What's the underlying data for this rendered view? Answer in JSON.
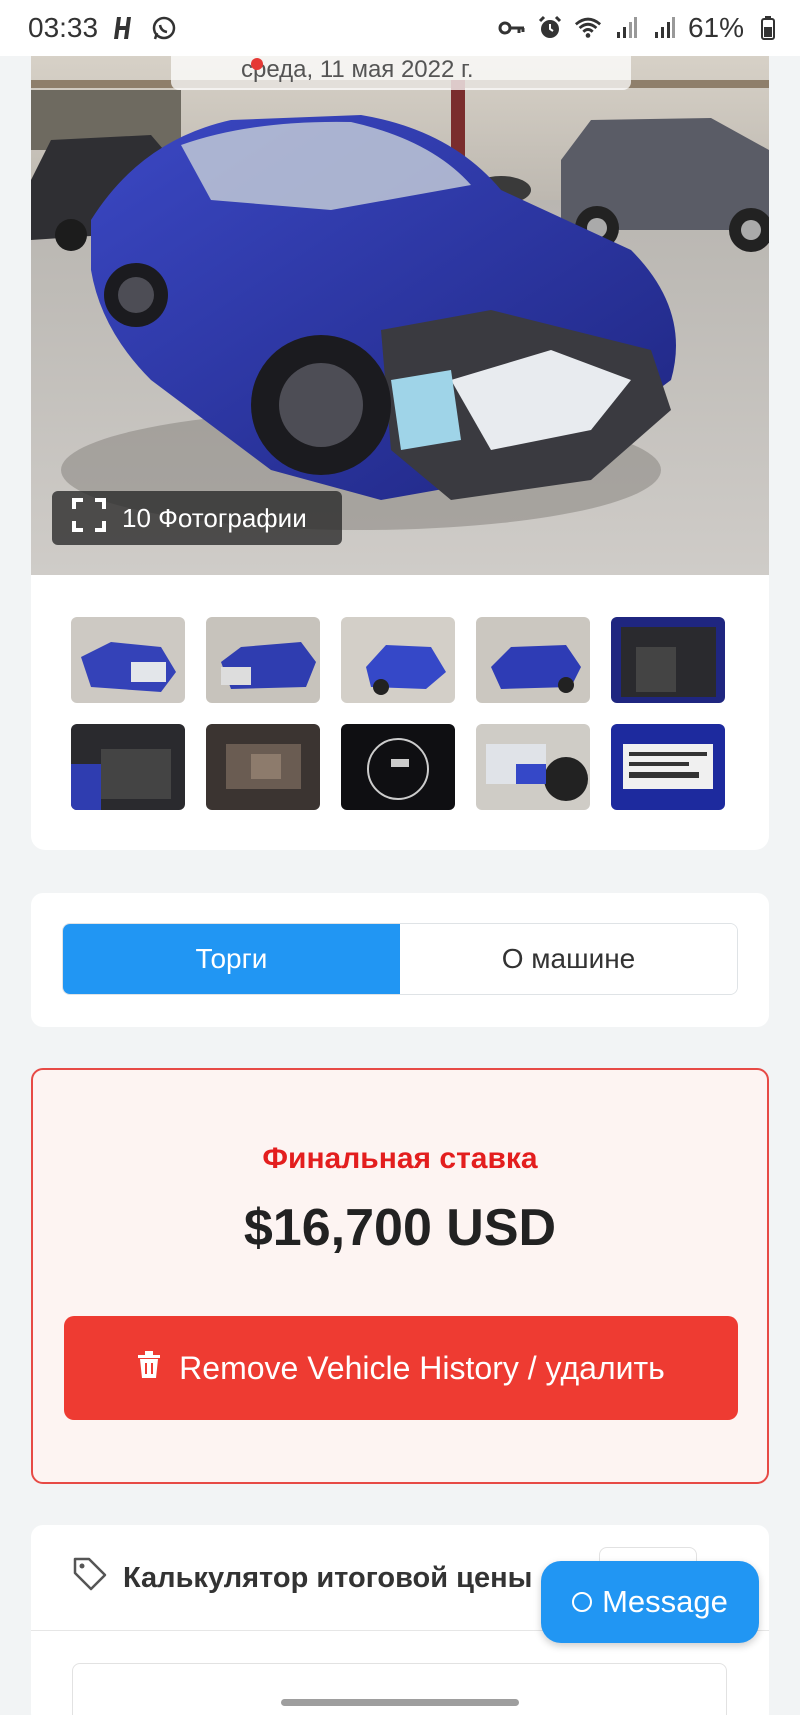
{
  "status_bar": {
    "time": "03:33",
    "battery": "61%",
    "icons": [
      "h-icon",
      "whatsapp-icon",
      "key-icon",
      "alarm-icon",
      "wifi-icon",
      "signal-icon",
      "signal-icon",
      "battery-icon"
    ]
  },
  "gallery": {
    "date_text": "среда, 11 мая 2022 г.",
    "photo_count_label": "10 Фотографии",
    "thumbnails": [
      {
        "name": "thumb-1"
      },
      {
        "name": "thumb-2"
      },
      {
        "name": "thumb-3"
      },
      {
        "name": "thumb-4"
      },
      {
        "name": "thumb-5"
      },
      {
        "name": "thumb-6"
      },
      {
        "name": "thumb-7"
      },
      {
        "name": "thumb-8"
      },
      {
        "name": "thumb-9"
      },
      {
        "name": "thumb-10"
      }
    ]
  },
  "tabs": {
    "auction": "Торги",
    "about_car": "О машине",
    "active": "auction"
  },
  "bid": {
    "label": "Финальная ставка",
    "amount": "$16,700 USD",
    "remove_button": "Remove Vehicle History / удалить"
  },
  "calculator": {
    "title": "Калькулятор итоговой цены"
  },
  "message_button": "Message",
  "colors": {
    "accent_blue": "#2196f3",
    "danger_red": "#ee3b32",
    "bid_label_red": "#e31e1e",
    "bid_bg": "#fdf4f2"
  }
}
